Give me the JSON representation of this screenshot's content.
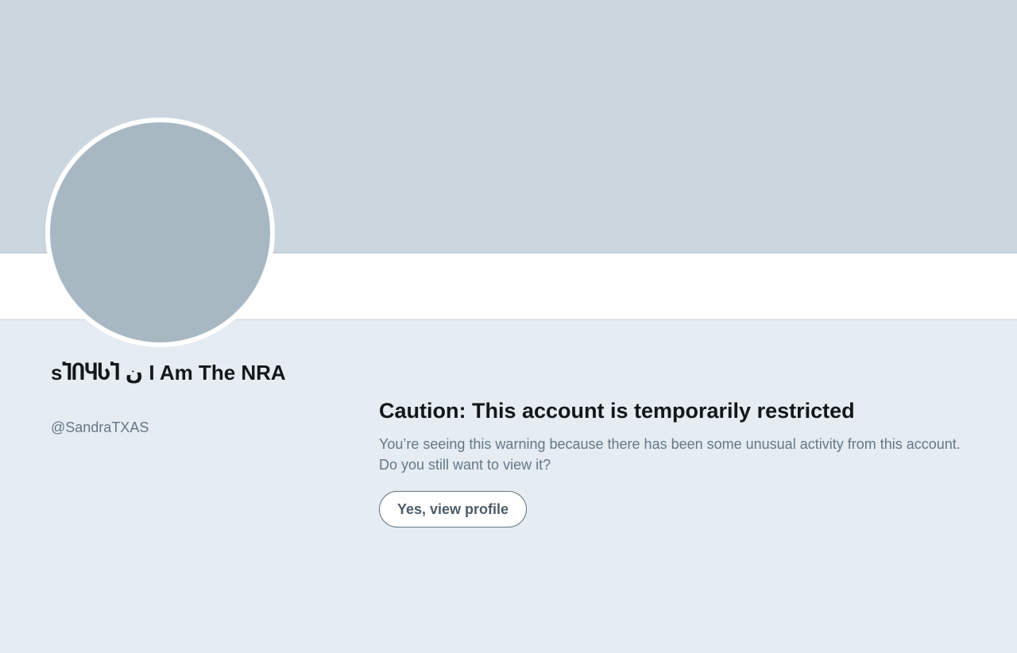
{
  "profile": {
    "display_name": "ѕႨႶႷႱႨ ن I Am The NRA",
    "handle": "@SandraTXAS"
  },
  "warning": {
    "title": "Caution: This account is temporarily restricted",
    "body": "You’re seeing this warning because there has been some unusual activity from this account. Do you still want to view it?",
    "button_label": "Yes, view profile"
  },
  "colors": {
    "banner": "#ccd6df",
    "page_background": "#e5ecf2",
    "avatar_placeholder": "#a8b8c3",
    "title_text": "#14171a",
    "secondary_text": "#657786"
  }
}
